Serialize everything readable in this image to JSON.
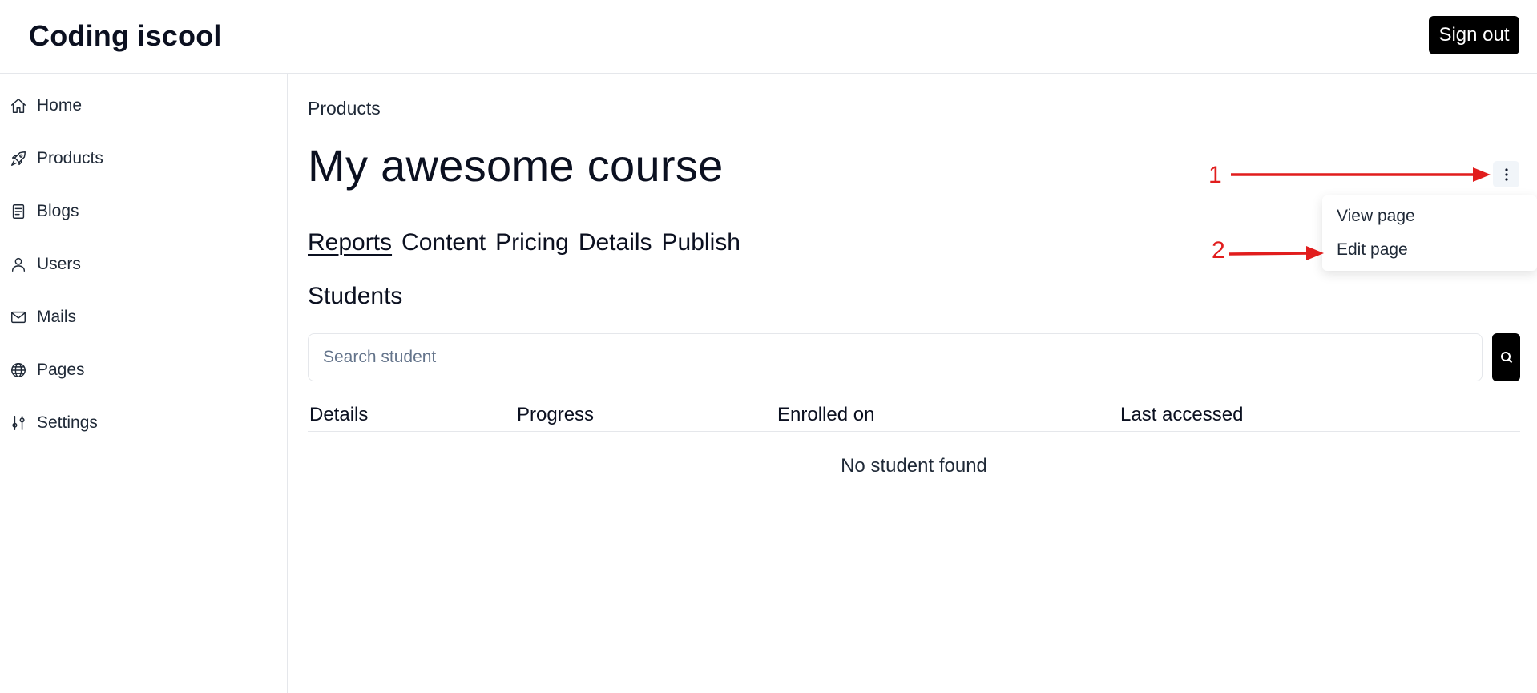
{
  "header": {
    "brand": "Coding iscool",
    "signout_label": "Sign out"
  },
  "sidebar": {
    "items": [
      {
        "label": "Home",
        "icon": "home-icon"
      },
      {
        "label": "Products",
        "icon": "rocket-icon"
      },
      {
        "label": "Blogs",
        "icon": "document-icon"
      },
      {
        "label": "Users",
        "icon": "user-icon"
      },
      {
        "label": "Mails",
        "icon": "mail-icon"
      },
      {
        "label": "Pages",
        "icon": "globe-icon"
      },
      {
        "label": "Settings",
        "icon": "sliders-icon"
      }
    ]
  },
  "main": {
    "breadcrumb": "Products",
    "title": "My awesome course",
    "tabs": [
      {
        "label": "Reports",
        "active": true
      },
      {
        "label": "Content"
      },
      {
        "label": "Pricing"
      },
      {
        "label": "Details"
      },
      {
        "label": "Publish"
      }
    ],
    "section_title": "Students",
    "search": {
      "placeholder": "Search student",
      "value": ""
    },
    "table": {
      "columns": [
        "Details",
        "Progress",
        "Enrolled on",
        "Last accessed"
      ],
      "empty_text": "No student found"
    }
  },
  "actions_menu": {
    "items": [
      "View page",
      "Edit page"
    ]
  },
  "annotations": {
    "labels": [
      "1",
      "2"
    ],
    "color": "#e11d1d"
  }
}
